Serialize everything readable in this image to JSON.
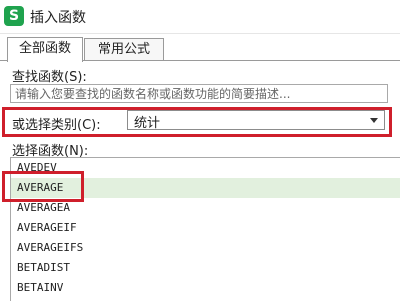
{
  "window": {
    "title": "插入函数",
    "app_icon_letter": "S",
    "app_icon_color": "#1fa34e"
  },
  "tabs": [
    {
      "label": "全部函数",
      "active": true
    },
    {
      "label": "常用公式",
      "active": false
    }
  ],
  "search": {
    "label": "查找函数(S):",
    "placeholder": "请输入您要查找的函数名称或函数功能的简要描述..."
  },
  "category": {
    "label": "或选择类别(C):",
    "value": "统计"
  },
  "function_list": {
    "label": "选择函数(N):",
    "items": [
      "AVEDEV",
      "AVERAGE",
      "AVERAGEA",
      "AVERAGEIF",
      "AVERAGEIFS",
      "BETADIST",
      "BETAINV"
    ],
    "selected": "AVERAGE"
  },
  "colors": {
    "highlight_red": "#cf1f2b",
    "selected_row": "#e2f0de"
  }
}
